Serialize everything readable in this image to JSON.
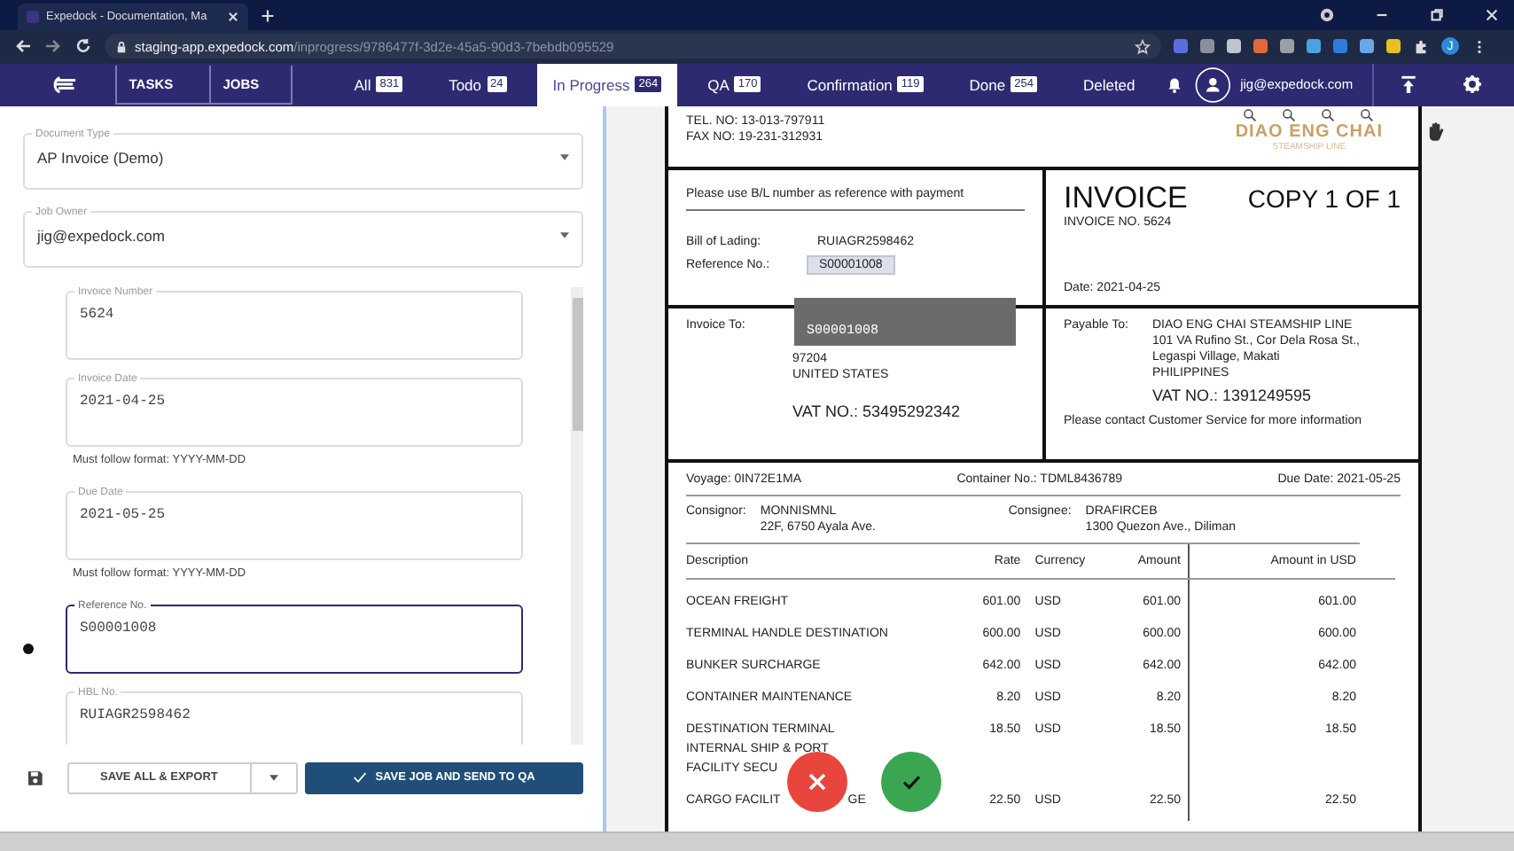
{
  "browser": {
    "tab_title": "Expedock - Documentation, Ma",
    "url_host": "staging-app.expedock.com",
    "url_path": "/inprogress/9786477f-3d2e-45a5-90d3-7bebdb095529",
    "profile_initial": "J"
  },
  "header": {
    "toggle": [
      "TASKS",
      "JOBS"
    ],
    "tabs": [
      {
        "label": "All",
        "count": "831",
        "selected": false
      },
      {
        "label": "Todo",
        "count": "24",
        "selected": false
      },
      {
        "label": "In Progress",
        "count": "264",
        "selected": true
      },
      {
        "label": "QA",
        "count": "170",
        "selected": false
      },
      {
        "label": "Confirmation",
        "count": "119",
        "selected": false
      },
      {
        "label": "Done",
        "count": "254",
        "selected": false
      },
      {
        "label": "Deleted",
        "selected": false
      }
    ],
    "user_email": "jig@expedock.com"
  },
  "form": {
    "selects": [
      {
        "label": "Document Type",
        "value": "AP Invoice (Demo)"
      },
      {
        "label": "Job Owner",
        "value": "jig@expedock.com"
      }
    ],
    "fields": [
      {
        "label": "Invoice Number",
        "value": "5624",
        "focused": false,
        "flagged": false
      },
      {
        "label": "Invoice Date",
        "value": "2021-04-25",
        "helper": "Must follow format: YYYY-MM-DD",
        "focused": false,
        "flagged": false
      },
      {
        "label": "Due Date",
        "value": "2021-05-25",
        "helper": "Must follow format: YYYY-MM-DD",
        "focused": false,
        "flagged": false
      },
      {
        "label": "Reference No.",
        "value": "S00001008",
        "focused": true,
        "flagged": true
      },
      {
        "label": "HBL No.",
        "value": "RUIAGR2598462",
        "focused": false,
        "flagged": false
      }
    ],
    "export_button": "SAVE ALL & EXPORT",
    "submit_button": "SAVE JOB AND SEND TO QA"
  },
  "document": {
    "contact": [
      "TEL. NO: 13-013-797911",
      "FAX NO: 19-231-312931"
    ],
    "logo": {
      "name": "DIAO ENG CHAI",
      "tagline": "STEAMSHIP LINE"
    },
    "payment_note": "Please use B/L number as reference with payment",
    "refs": [
      {
        "label": "Bill of Lading:",
        "value": "RUIAGR2598462",
        "highlighted": false
      },
      {
        "label": "Reference No.:",
        "value": "S00001008",
        "highlighted": true
      }
    ],
    "title": "INVOICE",
    "copy": "COPY 1 OF 1",
    "invoice_no": "INVOICE NO. 5624",
    "date": "Date: 2021-04-25",
    "invoice_to": {
      "label": "Invoice To:",
      "lines": [
        "97204",
        "UNITED STATES"
      ],
      "vat": "VAT NO.: 53495292342"
    },
    "payable_to": {
      "label": "Payable To:",
      "lines": [
        "DIAO ENG CHAI STEAMSHIP LINE",
        "101 VA Rufino St., Cor Dela Rosa St.,",
        "Legaspi Village, Makati",
        "PHILIPPINES"
      ],
      "vat": "VAT NO.: 1391249595"
    },
    "contact_note": "Please contact Customer Service for more information",
    "voyage": "Voyage: 0IN72E1MA",
    "container": "Container No.: TDML8436789",
    "due_date": "Due Date: 2021-05-25",
    "consignor": {
      "label": "Consignor:",
      "lines": [
        "MONNISMNL",
        "22F, 6750 Ayala Ave."
      ]
    },
    "consignee": {
      "label": "Consignee:",
      "lines": [
        "DRAFIRCEB",
        "1300 Quezon Ave., Diliman"
      ]
    },
    "columns": [
      "Description",
      "Rate",
      "Currency",
      "Amount",
      "Amount in USD"
    ],
    "rows": [
      {
        "description": [
          "OCEAN FREIGHT"
        ],
        "rate": "601.00",
        "currency": "USD",
        "amount": "601.00",
        "usd": "601.00"
      },
      {
        "description": [
          "TERMINAL HANDLE DESTINATION"
        ],
        "rate": "600.00",
        "currency": "USD",
        "amount": "600.00",
        "usd": "600.00"
      },
      {
        "description": [
          "BUNKER SURCHARGE"
        ],
        "rate": "642.00",
        "currency": "USD",
        "amount": "642.00",
        "usd": "642.00"
      },
      {
        "description": [
          "CONTAINER MAINTENANCE"
        ],
        "rate": "8.20",
        "currency": "USD",
        "amount": "8.20",
        "usd": "8.20"
      },
      {
        "description": [
          "DESTINATION TERMINAL",
          "INTERNAL SHIP & PORT",
          "FACILITY SECU"
        ],
        "rate": "18.50",
        "currency": "USD",
        "amount": "18.50",
        "usd": "18.50"
      },
      {
        "description": [
          "CARGO FACILIT"
        ],
        "description_end": "GE",
        "rate": "22.50",
        "currency": "USD",
        "amount": "22.50",
        "usd": "22.50"
      }
    ],
    "tooltip": "S00001008"
  }
}
